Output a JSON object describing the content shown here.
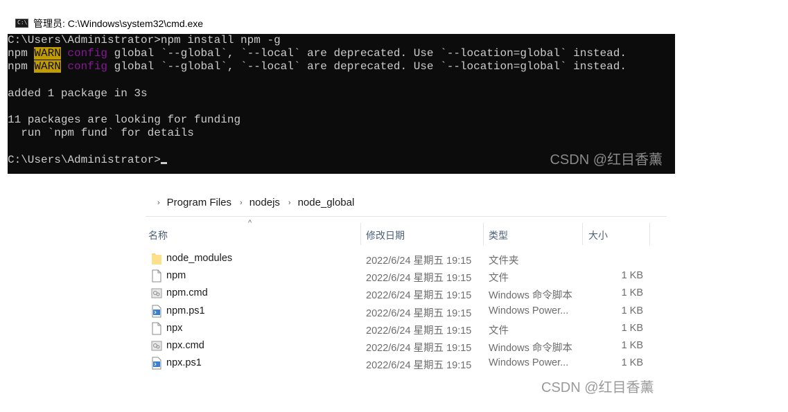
{
  "cmd_window": {
    "title": "管理员: C:\\Windows\\system32\\cmd.exe",
    "lines": [
      {
        "segments": [
          {
            "t": "C:\\Users\\Administrator>npm install npm -g",
            "c": "n"
          }
        ]
      },
      {
        "segments": [
          {
            "t": "npm ",
            "c": "n"
          },
          {
            "t": "WARN",
            "c": "w"
          },
          {
            "t": " ",
            "c": "n"
          },
          {
            "t": "config",
            "c": "p"
          },
          {
            "t": " global `--global`, `--local` are deprecated. Use `--location=global` instead.",
            "c": "n"
          }
        ]
      },
      {
        "segments": [
          {
            "t": "npm ",
            "c": "n"
          },
          {
            "t": "WARN",
            "c": "w"
          },
          {
            "t": " ",
            "c": "n"
          },
          {
            "t": "config",
            "c": "p"
          },
          {
            "t": " global `--global`, `--local` are deprecated. Use `--location=global` instead.",
            "c": "n"
          }
        ]
      },
      {
        "segments": [
          {
            "t": "",
            "c": "n"
          }
        ]
      },
      {
        "segments": [
          {
            "t": "added 1 package in 3s",
            "c": "n"
          }
        ]
      },
      {
        "segments": [
          {
            "t": "",
            "c": "n"
          }
        ]
      },
      {
        "segments": [
          {
            "t": "11 packages are looking for funding",
            "c": "n"
          }
        ]
      },
      {
        "segments": [
          {
            "t": "  run `npm fund` for details",
            "c": "n"
          }
        ]
      },
      {
        "segments": [
          {
            "t": "",
            "c": "n"
          }
        ]
      },
      {
        "segments": [
          {
            "t": "C:\\Users\\Administrator>",
            "c": "n"
          }
        ],
        "cursor": true
      }
    ],
    "watermark": "CSDN @红目香薰"
  },
  "explorer": {
    "breadcrumb": [
      "Program Files",
      "nodejs",
      "node_global"
    ],
    "columns": {
      "name": "名称",
      "date": "修改日期",
      "type": "类型",
      "size": "大小"
    },
    "files": [
      {
        "name": "node_modules",
        "date": "2022/6/24 星期五 19:15",
        "type": "文件夹",
        "size": "",
        "icon": "folder-icon"
      },
      {
        "name": "npm",
        "date": "2022/6/24 星期五 19:15",
        "type": "文件",
        "size": "1 KB",
        "icon": "file-icon"
      },
      {
        "name": "npm.cmd",
        "date": "2022/6/24 星期五 19:15",
        "type": "Windows 命令脚本",
        "size": "1 KB",
        "icon": "cmd-script-icon"
      },
      {
        "name": "npm.ps1",
        "date": "2022/6/24 星期五 19:15",
        "type": "Windows Power...",
        "size": "1 KB",
        "icon": "powershell-script-icon"
      },
      {
        "name": "npx",
        "date": "2022/6/24 星期五 19:15",
        "type": "文件",
        "size": "1 KB",
        "icon": "file-icon"
      },
      {
        "name": "npx.cmd",
        "date": "2022/6/24 星期五 19:15",
        "type": "Windows 命令脚本",
        "size": "1 KB",
        "icon": "cmd-script-icon"
      },
      {
        "name": "npx.ps1",
        "date": "2022/6/24 星期五 19:15",
        "type": "Windows Power...",
        "size": "1 KB",
        "icon": "powershell-script-icon"
      }
    ],
    "watermark": "CSDN @红目香薰"
  },
  "colors": {
    "terminal_bg": "#0c0c0c",
    "terminal_fg": "#cccccc",
    "warn_bg": "#c19c00",
    "config_fg": "#881798",
    "folder": "#f8d775"
  }
}
